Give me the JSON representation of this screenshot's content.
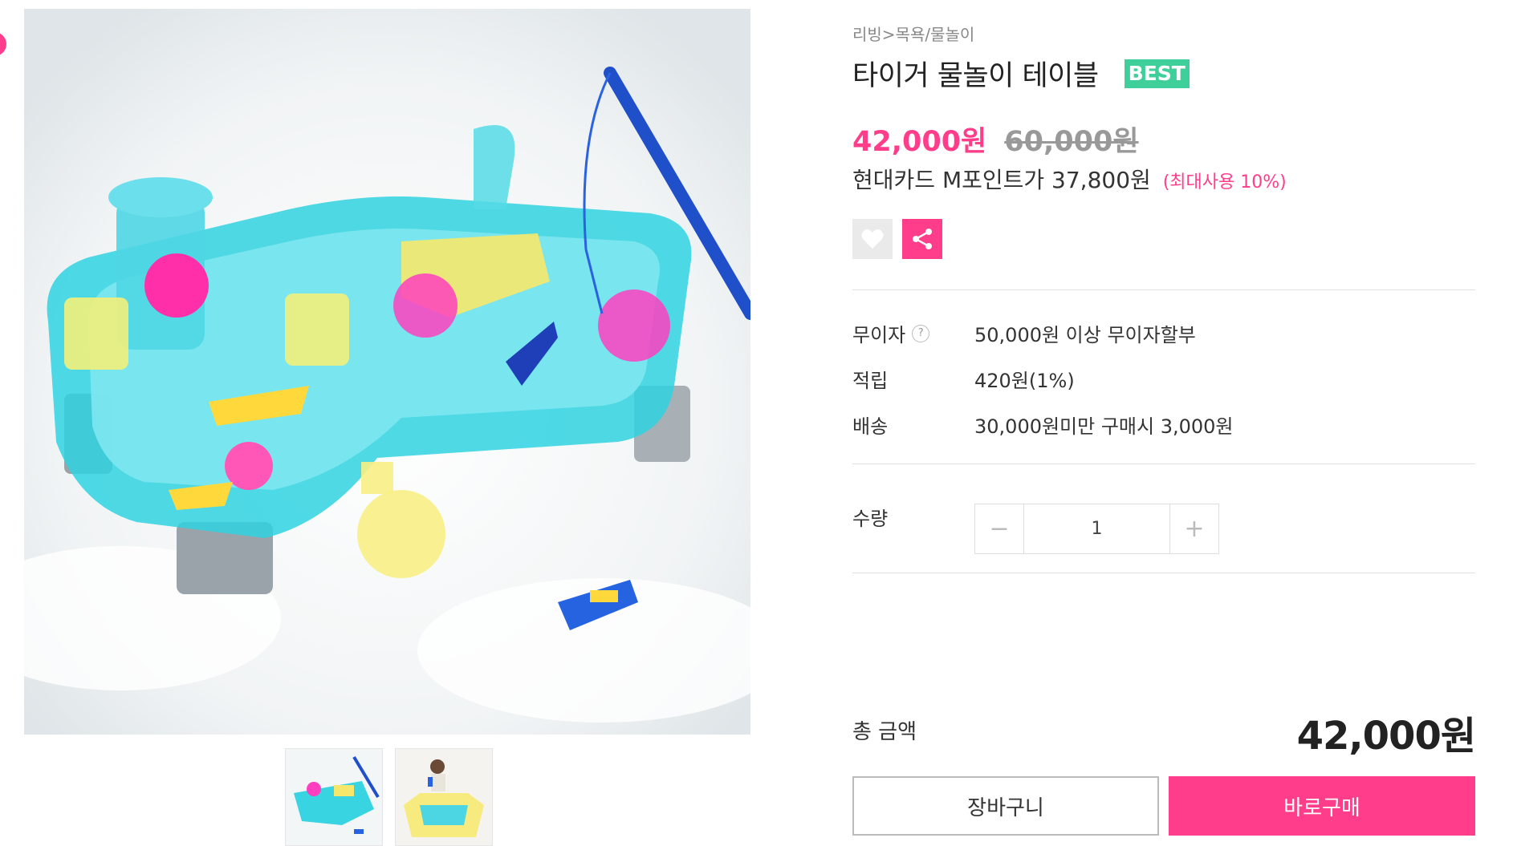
{
  "breadcrumb": "리빙>목욕/물놀이",
  "product": {
    "title": "타이거 물놀이 테이블",
    "badge": "BEST",
    "price": "42,000원",
    "original_price": "60,000원",
    "card_benefit": "현대카드 M포인트가 37,800원",
    "card_benefit_note": "(최대사용 10%)"
  },
  "icons": {
    "like": "heart-icon",
    "share": "share-icon"
  },
  "specs": [
    {
      "label": "무이자",
      "value": "50,000원 이상 무이자할부",
      "help": "?"
    },
    {
      "label": "적립",
      "value": "420원(1%)"
    },
    {
      "label": "배송",
      "value": "30,000원미만 구매시 3,000원"
    }
  ],
  "quantity": {
    "label": "수량",
    "value": "1",
    "minus": "−",
    "plus": "+"
  },
  "total": {
    "label": "총 금액",
    "value": "42,000원"
  },
  "buttons": {
    "cart": "장바구니",
    "buy": "바로구매"
  },
  "colors": {
    "accent": "#ff3d8b",
    "best_badge": "#3fcf9a"
  }
}
